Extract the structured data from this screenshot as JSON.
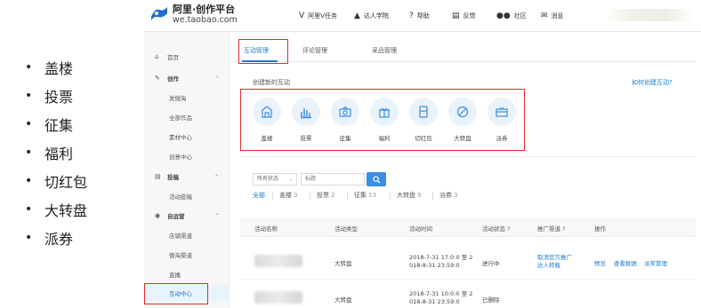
{
  "bullets": [
    "盖楼",
    "投票",
    "征集",
    "福利",
    "切红包",
    "大转盘",
    "派券"
  ],
  "brand": {
    "title": "阿里·创作平台",
    "subtitle": "we.taobao.com"
  },
  "topnav": [
    {
      "icon": "v-icon",
      "glyph": "V",
      "label": "阿里V任务"
    },
    {
      "icon": "graduation-cap-icon",
      "glyph": "🎓",
      "label": "达人学院"
    },
    {
      "icon": "help-icon",
      "glyph": "?",
      "label": "帮助"
    },
    {
      "icon": "feedback-icon",
      "glyph": "▤",
      "label": "反馈"
    },
    {
      "icon": "community-icon",
      "glyph": "👥",
      "label": "社区"
    },
    {
      "icon": "message-icon",
      "glyph": "✉",
      "label": "消息"
    }
  ],
  "sidebar": [
    {
      "type": "item",
      "icon": "home-icon",
      "glyph": "⌂",
      "label": "首页"
    },
    {
      "type": "group",
      "icon": "pencil-icon",
      "glyph": "✎",
      "label": "创作",
      "caret": "⌃"
    },
    {
      "type": "sub",
      "label": "发微淘"
    },
    {
      "type": "sub",
      "label": "全部作品"
    },
    {
      "type": "sub",
      "label": "素材中心"
    },
    {
      "type": "sub",
      "label": "创意中心"
    },
    {
      "type": "group",
      "icon": "document-icon",
      "glyph": "▤",
      "label": "投稿",
      "caret": "⌃"
    },
    {
      "type": "sub",
      "label": "活动投稿"
    },
    {
      "type": "group",
      "icon": "operations-icon",
      "glyph": "◉",
      "label": "自运营",
      "caret": "⌃"
    },
    {
      "type": "sub",
      "label": "店铺渠道"
    },
    {
      "type": "sub",
      "label": "微淘渠道"
    },
    {
      "type": "sub",
      "label": "直播"
    },
    {
      "type": "sub",
      "label": "互动中心",
      "active": true
    }
  ],
  "tabs": [
    "互动管理",
    "评论管理",
    "采品管理"
  ],
  "create": {
    "title": "创建新的互动",
    "help_link": "如何创建互动?",
    "types": [
      {
        "icon": "building-icon",
        "label": "盖楼"
      },
      {
        "icon": "bar-chart-icon",
        "label": "投票"
      },
      {
        "icon": "camera-icon",
        "label": "征集"
      },
      {
        "icon": "gift-icon",
        "label": "福利"
      },
      {
        "icon": "red-packet-icon",
        "label": "切红包"
      },
      {
        "icon": "wheel-icon",
        "label": "大转盘"
      },
      {
        "icon": "coupon-icon",
        "label": "派券"
      }
    ]
  },
  "filter": {
    "status_value": "所有状态",
    "search_placeholder": "标题",
    "categories": [
      {
        "label": "全部",
        "count": ""
      },
      {
        "label": "盖楼",
        "count": "3"
      },
      {
        "label": "投票",
        "count": "2"
      },
      {
        "label": "征集",
        "count": "13"
      },
      {
        "label": "大转盘",
        "count": "9"
      },
      {
        "label": "派券",
        "count": "3"
      }
    ]
  },
  "table": {
    "headers": [
      "活动名称",
      "活动类型",
      "活动时间",
      "活动状态 ?",
      "推广渠道 ?",
      "操作"
    ],
    "rows": [
      {
        "type": "大转盘",
        "time_line1": "2018-7-31 17:0:0 至 2",
        "time_line2": "018-8-31 23:59:0",
        "status": "进行中",
        "channel_line1": "取消官方推广",
        "channel_line2": "达人转载",
        "actions": [
          "预览",
          "查看数据",
          "派奖管理"
        ]
      },
      {
        "type": "大转盘",
        "time_line1": "2018-7-31 10:0:0 至 2",
        "time_line2": "018-8-31 23:59:0",
        "status": "已删除",
        "channel_line1": "",
        "channel_line2": "",
        "actions": []
      }
    ]
  },
  "colors": {
    "accent": "#1a7bd4",
    "highlight_box": "#e02b2b"
  }
}
